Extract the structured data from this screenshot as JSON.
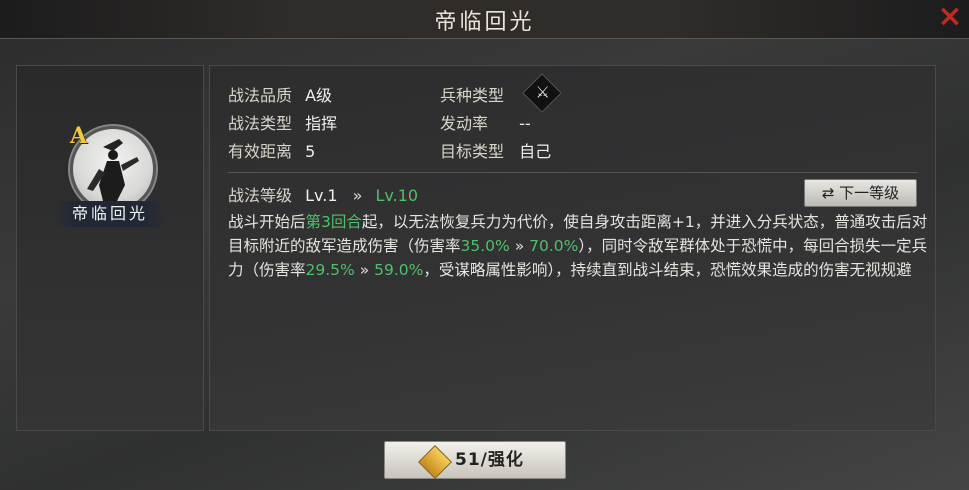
{
  "header": {
    "title": "帝临回光",
    "close_icon": "×"
  },
  "tactic": {
    "grade": "A",
    "portrait_name": "帝临回光",
    "quality_label": "战法品质",
    "quality_value": "A级",
    "type_label": "战法类型",
    "type_value": "指挥",
    "range_label": "有效距离",
    "range_value": "5",
    "arms_label": "兵种类型",
    "arms_icon": "crossed-weapons-icon",
    "arms_glyph": "⚔",
    "rate_label": "发动率",
    "rate_value": "--",
    "target_label": "目标类型",
    "target_value": "自己",
    "level_label": "战法等级",
    "level_current": "Lv.1",
    "level_arrow": "»",
    "level_max": "Lv.10",
    "next_level_button": "⇄ 下一等级",
    "description": {
      "p1": "战斗开始后",
      "turn": "第3回合",
      "p2": "起，以无法恢复兵力为代价，使自身攻击距离+1，并进入分兵状态，普通攻击后对目标附近的敌军造成伤害（伤害率",
      "dmg1_from": "35.0%",
      "arrow1": " » ",
      "dmg1_to": "70.0%",
      "p3": "），同时令敌军群体处于恐慌中，每回合损失一定兵力（伤害率",
      "dmg2_from": "29.5%",
      "arrow2": " » ",
      "dmg2_to": "59.0%",
      "p4": "，受谋略属性影响），持续直到战斗结束，恐慌效果造成的伤害无视规避"
    }
  },
  "footer": {
    "enhance_label": "51/强化"
  },
  "colors": {
    "green_highlight": "#4fc06a",
    "close_red": "#c02a20",
    "grade_gold": "#f0c93c"
  }
}
